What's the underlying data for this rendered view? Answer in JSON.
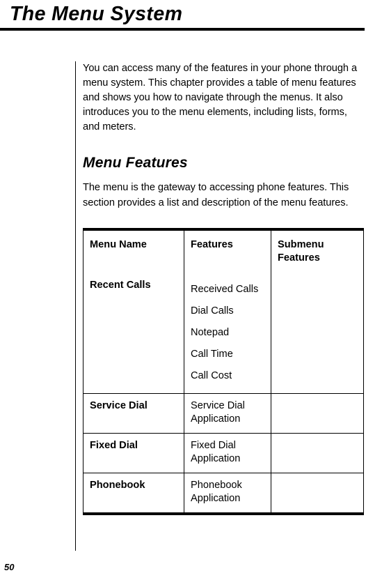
{
  "page": {
    "chapter_title": "The Menu System",
    "page_number": "50"
  },
  "intro": {
    "paragraph": "You can access many of the features in your phone through a menu system. This chapter provides a table of menu features and shows you how to navigate through the menus. It also introduces you to the menu elements, including lists, forms, and meters."
  },
  "section": {
    "heading": "Menu Features",
    "paragraph": "The menu is the gateway to accessing phone features. This section provides a list and description of the menu features."
  },
  "table": {
    "headers": {
      "menu_name": "Menu Name",
      "features": "Features",
      "submenu_features_line1": "Submenu",
      "submenu_features_line2": "Features"
    },
    "rows": [
      {
        "menu_name": "Recent Calls",
        "features": [
          "Received Calls",
          "Dial Calls",
          "Notepad",
          "Call Time",
          "Call Cost"
        ],
        "submenu_features": []
      },
      {
        "menu_name": "Service Dial",
        "features": [
          "Service Dial",
          "Application"
        ],
        "submenu_features": []
      },
      {
        "menu_name": "Fixed Dial",
        "features": [
          "Fixed Dial",
          "Application"
        ],
        "submenu_features": []
      },
      {
        "menu_name": "Phonebook",
        "features": [
          "Phonebook",
          "Application"
        ],
        "submenu_features": []
      }
    ]
  }
}
